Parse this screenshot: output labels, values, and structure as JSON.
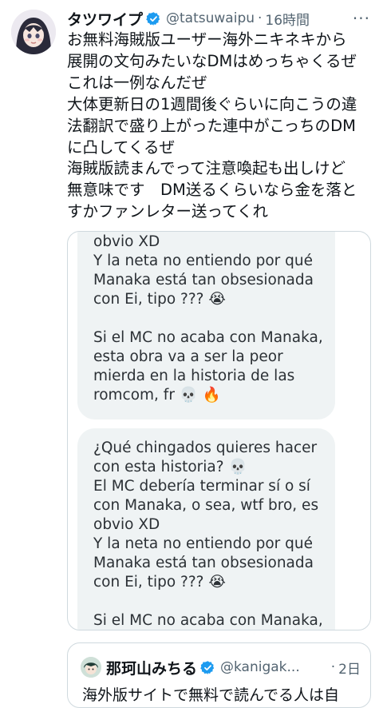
{
  "tweet": {
    "author_name": "タツワイプ",
    "handle": "@tatsuwaipu",
    "separator": "·",
    "time": "16時間",
    "more": "···",
    "text_lines": [
      "お無料海賊版ユーザー海外ニキネキから",
      "展開の文句みたいなDMはめっちゃくるぜ",
      "これは一例なんだぜ",
      "大体更新日の1週間後ぐらいに向こうの違",
      "法翻訳で盛り上がった連中がこっちのDM",
      "に凸してくるぜ",
      "海賊版読まんでって注意喚起も出しけど",
      "無意味です　DM送るくらいなら金を落と",
      "すかファンレター送ってくれ"
    ]
  },
  "dm_screenshot": {
    "bubble_1_lines": [
      "obvio XD",
      "Y la neta no entiendo por qué",
      "Manaka está tan obsesionada",
      "con Ei, tipo ??? 😭",
      "",
      "Si el MC no acaba con Manaka,",
      "esta obra va a ser la peor",
      "mierda en la historia de las",
      "romcom, fr 💀 🔥"
    ],
    "bubble_2_lines": [
      "¿Qué chingados quieres hacer",
      "con esta historia? 💀",
      "El MC debería terminar sí o sí",
      "con Manaka, o sea, wtf bro, es",
      "obvio XD",
      "Y la neta no entiendo por qué",
      "Manaka está tan obsesionada",
      "con Ei, tipo ??? 😭",
      "",
      "Si el MC no acaba con Manaka,"
    ]
  },
  "quote_tweet": {
    "author_name": "那珂山みちる",
    "handle": "@kanigak...",
    "separator": "·",
    "time": "2日",
    "text_partial": "海外版サイトで無料で読んでる人は自"
  },
  "colors": {
    "text": "#0f1419",
    "secondary": "#536471",
    "verified_blue": "#1d9bf0",
    "bubble_bg": "#eff3f4",
    "border": "#cfd9de"
  },
  "icons": [
    "avatar",
    "verified-badge-icon",
    "more-icon"
  ]
}
